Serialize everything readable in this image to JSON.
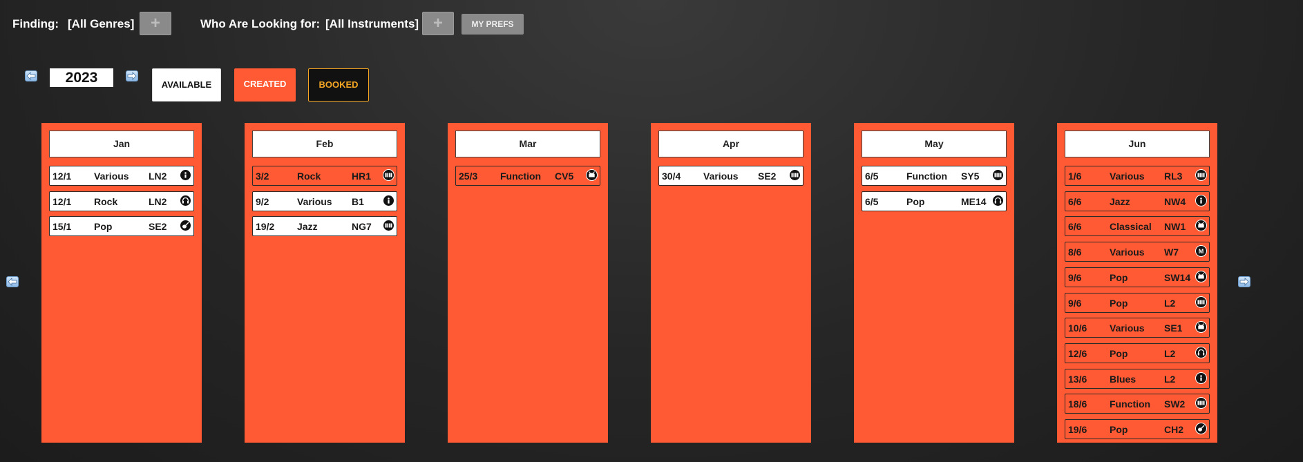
{
  "filters": {
    "finding_label": "Finding:",
    "genres_value": "[All Genres]",
    "looking_label": "Who Are Looking for:",
    "instruments_value": "[All Instruments]",
    "add_symbol": "+",
    "my_prefs_label": "MY PREFS"
  },
  "year_nav": {
    "year": "2023",
    "prev_icon": "arrow-left-icon",
    "next_icon": "arrow-right-icon"
  },
  "status_buttons": {
    "available": "AVAILABLE",
    "created": "CREATED",
    "booked": "BOOKED"
  },
  "colors": {
    "accent": "#ff5a33",
    "booked_text": "#f5a623",
    "background": "#262626"
  },
  "months": [
    {
      "name": "Jan",
      "gigs": [
        {
          "date": "12/1",
          "genre": "Various",
          "code": "LN2",
          "icon": "info-icon",
          "status": "available"
        },
        {
          "date": "12/1",
          "genre": "Rock",
          "code": "LN2",
          "icon": "headphones-icon",
          "status": "available"
        },
        {
          "date": "15/1",
          "genre": "Pop",
          "code": "SE2",
          "icon": "guitar-icon",
          "status": "available"
        }
      ]
    },
    {
      "name": "Feb",
      "gigs": [
        {
          "date": "3/2",
          "genre": "Rock",
          "code": "HR1",
          "icon": "keyboard-icon",
          "status": "created"
        },
        {
          "date": "9/2",
          "genre": "Various",
          "code": "B1",
          "icon": "info-icon",
          "status": "available"
        },
        {
          "date": "19/2",
          "genre": "Jazz",
          "code": "NG7",
          "icon": "keyboard-icon",
          "status": "available"
        }
      ]
    },
    {
      "name": "Mar",
      "gigs": [
        {
          "date": "25/3",
          "genre": "Function",
          "code": "CV5",
          "icon": "drum-icon",
          "status": "created"
        }
      ]
    },
    {
      "name": "Apr",
      "gigs": [
        {
          "date": "30/4",
          "genre": "Various",
          "code": "SE2",
          "icon": "keyboard-icon",
          "status": "available"
        }
      ]
    },
    {
      "name": "May",
      "gigs": [
        {
          "date": "6/5",
          "genre": "Function",
          "code": "SY5",
          "icon": "keyboard-icon",
          "status": "available"
        },
        {
          "date": "6/5",
          "genre": "Pop",
          "code": "ME14",
          "icon": "headphones-icon",
          "status": "available"
        }
      ]
    },
    {
      "name": "Jun",
      "gigs": [
        {
          "date": "1/6",
          "genre": "Various",
          "code": "RL3",
          "icon": "keyboard-icon",
          "status": "created"
        },
        {
          "date": "6/6",
          "genre": "Jazz",
          "code": "NW4",
          "icon": "info-icon",
          "status": "created"
        },
        {
          "date": "6/6",
          "genre": "Classical",
          "code": "NW1",
          "icon": "drum-icon",
          "status": "created"
        },
        {
          "date": "8/6",
          "genre": "Various",
          "code": "W7",
          "icon": "microphone-icon",
          "status": "created"
        },
        {
          "date": "9/6",
          "genre": "Pop",
          "code": "SW14",
          "icon": "drum-icon",
          "status": "created"
        },
        {
          "date": "9/6",
          "genre": "Pop",
          "code": "L2",
          "icon": "keyboard-icon",
          "status": "created"
        },
        {
          "date": "10/6",
          "genre": "Various",
          "code": "SE1",
          "icon": "drum-icon",
          "status": "created"
        },
        {
          "date": "12/6",
          "genre": "Pop",
          "code": "L2",
          "icon": "headphones-icon",
          "status": "created"
        },
        {
          "date": "13/6",
          "genre": "Blues",
          "code": "L2",
          "icon": "info-icon",
          "status": "created"
        },
        {
          "date": "18/6",
          "genre": "Function",
          "code": "SW2",
          "icon": "keyboard-icon",
          "status": "created"
        },
        {
          "date": "19/6",
          "genre": "Pop",
          "code": "CH2",
          "icon": "guitar-icon",
          "status": "created"
        }
      ]
    }
  ],
  "page_nav": {
    "prev_icon": "arrow-left-icon",
    "next_icon": "arrow-right-icon"
  }
}
